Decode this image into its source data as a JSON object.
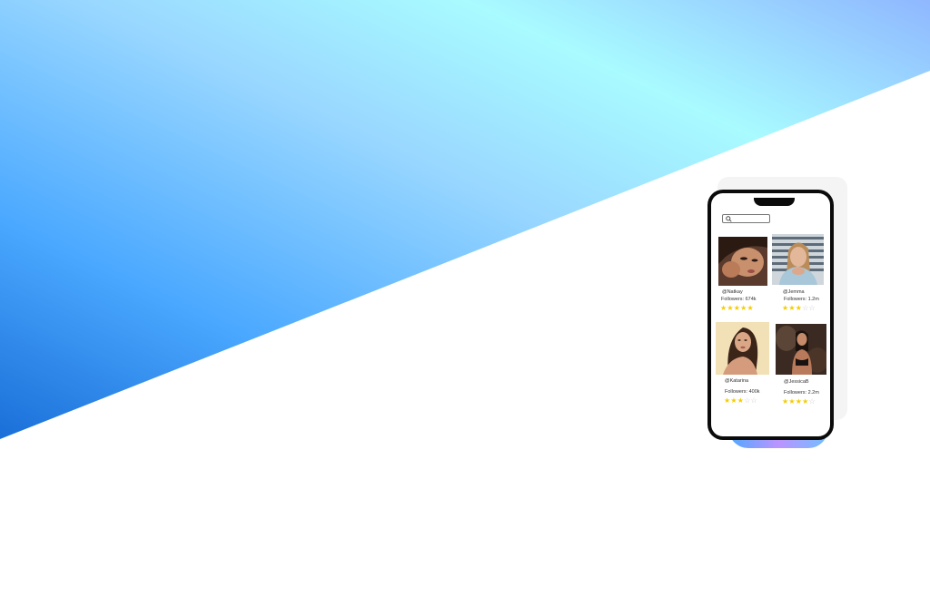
{
  "search": {
    "placeholder": ""
  },
  "profiles": [
    {
      "handle": "@Natkay",
      "followers": "Followers: 674k",
      "rating": 5,
      "max_rating": 5,
      "photo": "portrait-photo"
    },
    {
      "handle": "@Jemma",
      "followers": "Followers: 1.2m",
      "rating": 3,
      "max_rating": 5,
      "photo": "portrait-photo"
    },
    {
      "handle": "@Katarina",
      "followers": "Followers: 400k",
      "rating": 3,
      "max_rating": 5,
      "photo": "portrait-photo"
    },
    {
      "handle": "@JessicaB",
      "followers": "Followers: 2.2m",
      "rating": 4,
      "max_rating": 5,
      "photo": "portrait-photo"
    }
  ],
  "colors": {
    "gradient_start": "#1f7fe0",
    "gradient_mid": "#7ecbff",
    "gradient_end": "#a6fbff",
    "star": "#f5cc00",
    "phone_frame": "#0b0b0b"
  }
}
